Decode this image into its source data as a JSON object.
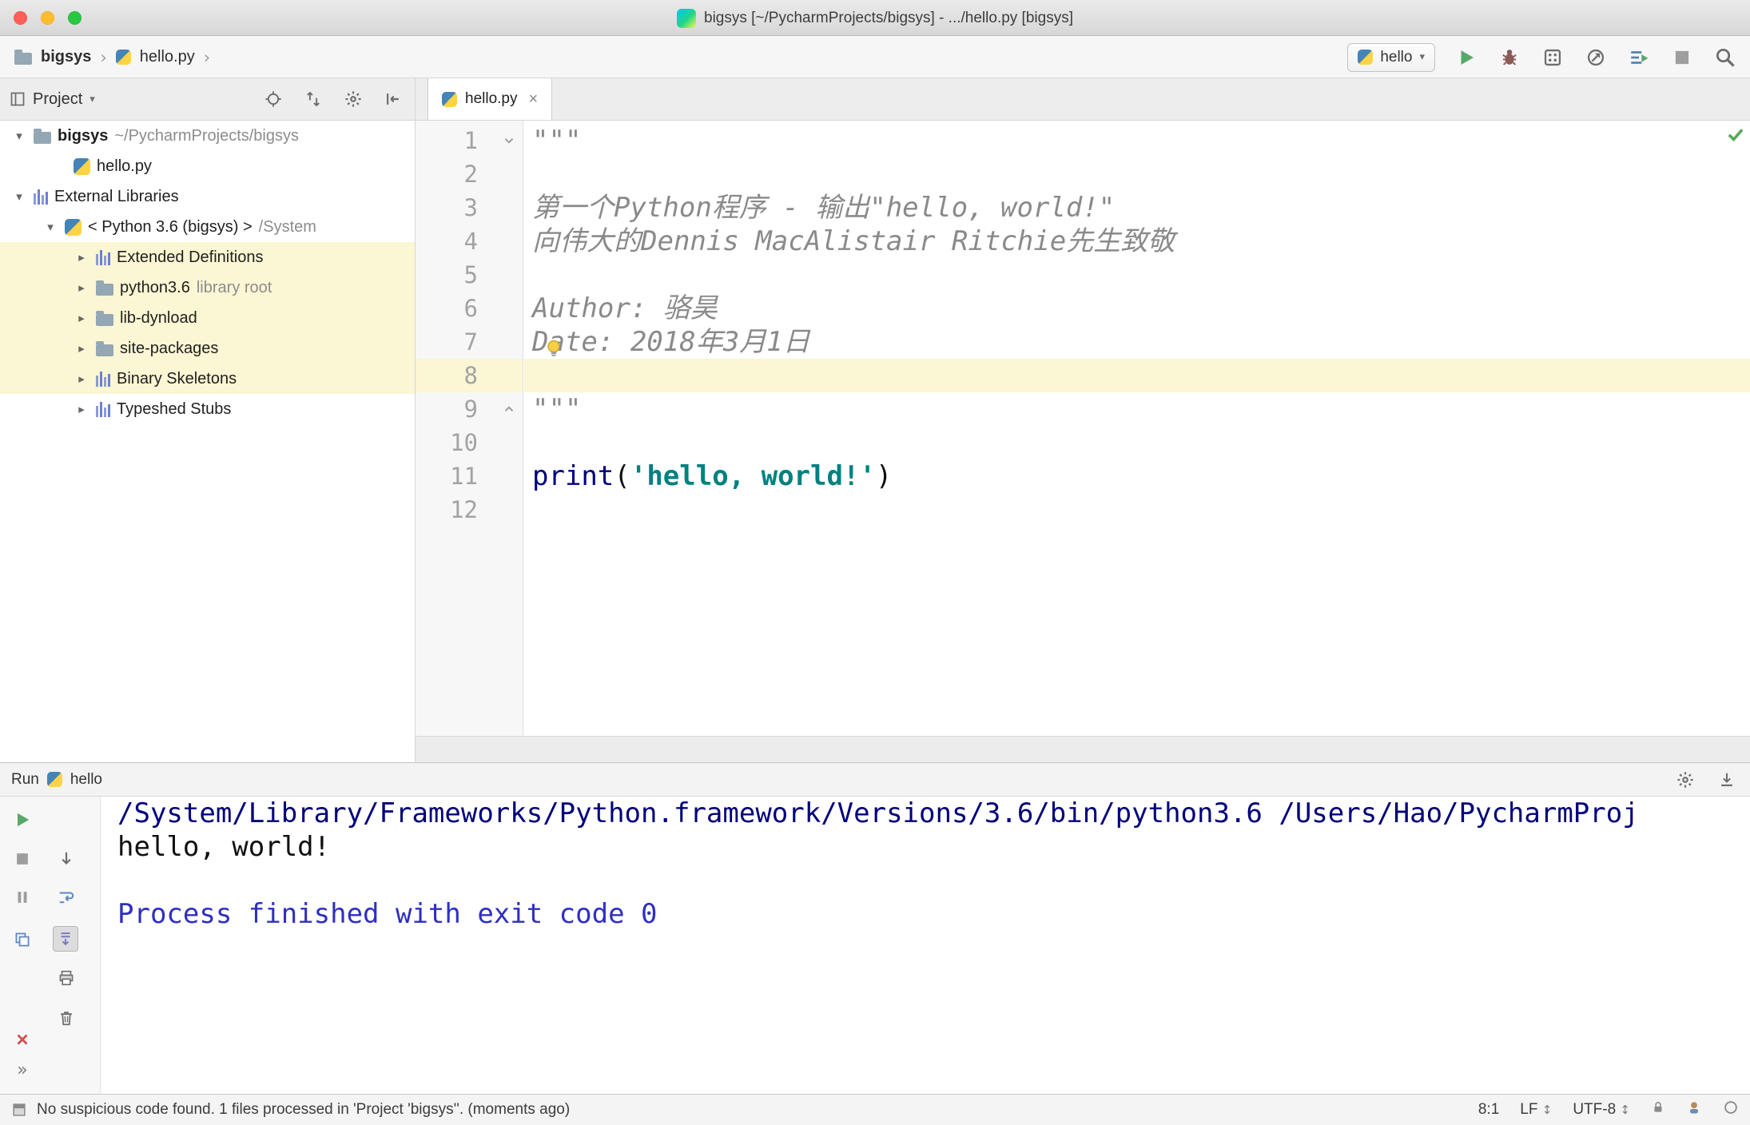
{
  "window": {
    "title": "bigsys [~/PycharmProjects/bigsys] - .../hello.py [bigsys]"
  },
  "navbar": {
    "breadcrumb_project": "bigsys",
    "breadcrumb_file": "hello.py",
    "run_config": "hello"
  },
  "project_panel": {
    "title": "Project",
    "tree": [
      {
        "label": "bigsys",
        "suffix": "~/PycharmProjects/bigsys",
        "icon": "folder",
        "arrow": "down",
        "indent": 0,
        "bold": true
      },
      {
        "label": "hello.py",
        "icon": "python",
        "arrow": null,
        "indent": 2
      },
      {
        "label": "External Libraries",
        "icon": "library",
        "arrow": "down",
        "indent": 0
      },
      {
        "label": "< Python 3.6 (bigsys) >",
        "suffix": "/System",
        "icon": "python",
        "arrow": "down",
        "indent": 1
      },
      {
        "label": "Extended Definitions",
        "icon": "library",
        "arrow": "right",
        "indent": 2,
        "highlight": true
      },
      {
        "label": "python3.6",
        "suffix": "library root",
        "icon": "folder",
        "arrow": "right",
        "indent": 2,
        "highlight": true
      },
      {
        "label": "lib-dynload",
        "icon": "folder",
        "arrow": "right",
        "indent": 2,
        "highlight": true
      },
      {
        "label": "site-packages",
        "icon": "folder",
        "arrow": "right",
        "indent": 2,
        "highlight": true
      },
      {
        "label": "Binary Skeletons",
        "icon": "library",
        "arrow": "right",
        "indent": 2,
        "highlight": true
      },
      {
        "label": "Typeshed Stubs",
        "icon": "library",
        "arrow": "right",
        "indent": 2
      }
    ]
  },
  "editor": {
    "tab_label": "hello.py",
    "lines": [
      {
        "num": 1,
        "segments": [
          {
            "style": "docstring",
            "text": "\"\"\""
          }
        ]
      },
      {
        "num": 2,
        "segments": []
      },
      {
        "num": 3,
        "segments": [
          {
            "style": "docstring",
            "text": "第一个Python程序 - 输出\"hello, world!\""
          }
        ]
      },
      {
        "num": 4,
        "segments": [
          {
            "style": "docstring",
            "text": "向伟大的Dennis MacAlistair Ritchie先生致敬"
          }
        ]
      },
      {
        "num": 5,
        "segments": []
      },
      {
        "num": 6,
        "segments": [
          {
            "style": "docstring",
            "text": "Author: 骆昊"
          }
        ]
      },
      {
        "num": 7,
        "segments": [
          {
            "style": "docstring",
            "text": "Date: 2018年3月1日"
          }
        ]
      },
      {
        "num": 8,
        "segments": [],
        "current": true
      },
      {
        "num": 9,
        "segments": [
          {
            "style": "docstring",
            "text": "\"\"\""
          }
        ]
      },
      {
        "num": 10,
        "segments": []
      },
      {
        "num": 11,
        "segments": [
          {
            "style": "keyword",
            "text": "print"
          },
          {
            "style": "plain",
            "text": "("
          },
          {
            "style": "string",
            "text": "'hello, world!'"
          },
          {
            "style": "plain",
            "text": ")"
          }
        ]
      },
      {
        "num": 12,
        "segments": []
      }
    ]
  },
  "run_panel": {
    "title": "Run",
    "config": "hello",
    "console": [
      {
        "style": "cmd",
        "text": "/System/Library/Frameworks/Python.framework/Versions/3.6/bin/python3.6 /Users/Hao/PycharmProj"
      },
      {
        "style": "out",
        "text": "hello, world!"
      },
      {
        "style": "out",
        "text": ""
      },
      {
        "style": "sys",
        "text": "Process finished with exit code 0"
      }
    ]
  },
  "statusbar": {
    "message": "No suspicious code found. 1 files processed in 'Project 'bigsys''. (moments ago)",
    "caret_position": "8:1",
    "line_separator": "LF",
    "encoding": "UTF-8"
  },
  "icon_glyphs": {
    "chevron-down": "▾",
    "chevron-right": "▸",
    "breadcrumb-separator": "›",
    "dropdown": "▾",
    "more-actions": "»",
    "close": "×",
    "updown": "↕"
  },
  "colors": {
    "run_green": "#59a869",
    "highlight_yellow": "#fbf6d3",
    "string_teal": "#008080",
    "console_blue": "#2f2fc1"
  }
}
